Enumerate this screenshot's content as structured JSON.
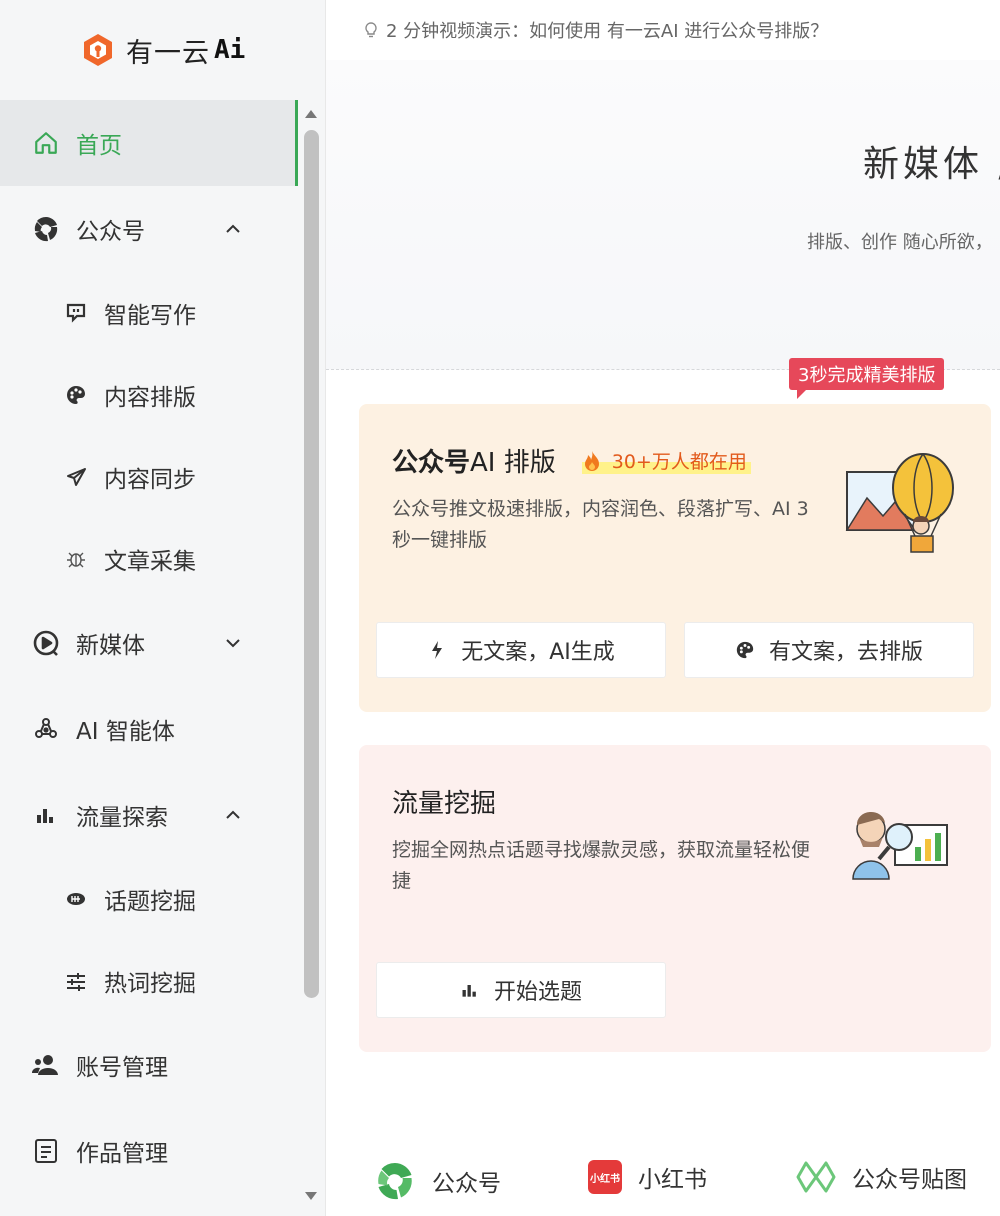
{
  "brand": {
    "name": "有一云",
    "ai_mark": "Ai",
    "logo_color": "#f0672b"
  },
  "sidebar": {
    "accent": "#3aa856",
    "items": [
      {
        "label": "首页",
        "icon": "home-icon",
        "level": "top",
        "active": true
      },
      {
        "label": "公众号",
        "icon": "wechat-official-icon",
        "level": "top",
        "chevron": "up"
      },
      {
        "label": "智能写作",
        "icon": "chat-write-icon",
        "level": "sub"
      },
      {
        "label": "内容排版",
        "icon": "palette-icon",
        "level": "sub"
      },
      {
        "label": "内容同步",
        "icon": "send-icon",
        "level": "sub"
      },
      {
        "label": "文章采集",
        "icon": "bug-icon",
        "level": "sub"
      },
      {
        "label": "新媒体",
        "icon": "play-circle-icon",
        "level": "top",
        "chevron": "down"
      },
      {
        "label": "AI 智能体",
        "icon": "agent-icon",
        "level": "top"
      },
      {
        "label": "流量探索",
        "icon": "bar-chart-icon",
        "level": "top",
        "chevron": "up"
      },
      {
        "label": "话题挖掘",
        "icon": "topic-icon",
        "level": "sub"
      },
      {
        "label": "热词挖掘",
        "icon": "sliders-icon",
        "level": "sub"
      },
      {
        "label": "账号管理",
        "icon": "users-icon",
        "level": "top"
      },
      {
        "label": "作品管理",
        "icon": "document-icon",
        "level": "top"
      }
    ]
  },
  "tip": {
    "text": "2 分钟视频演示：如何使用 有一云AI 进行公众号排版？"
  },
  "hero": {
    "title": "新媒体 /",
    "subtitle": "排版、创作 随心所欲，"
  },
  "ribbon": {
    "text": "3秒完成精美排版",
    "color": "#e6485a"
  },
  "cards": [
    {
      "title_bold": "公众号",
      "title_rest": " AI 排版",
      "badge": "30+万人都在用",
      "desc": "公众号推文极速排版，内容润色、段落扩写、AI 3秒一键排版",
      "bg": "#fdf1e2",
      "buttons": [
        {
          "label": "无文案，AI生成",
          "icon": "flash-icon"
        },
        {
          "label": "有文案，去排版",
          "icon": "palette-icon"
        }
      ]
    },
    {
      "title": "流量挖掘",
      "desc": "挖掘全网热点话题寻找爆款灵感，获取流量轻松便捷",
      "bg": "#fdf0ee",
      "buttons": [
        {
          "label": "开始选题",
          "icon": "bar-chart-icon"
        }
      ]
    }
  ],
  "platforms": [
    {
      "label": "公众号",
      "icon": "wechat-official-icon"
    },
    {
      "label": "小红书",
      "icon": "xiaohongshu-icon",
      "icon_text": "小红书"
    },
    {
      "label": "公众号贴图",
      "icon": "image-post-icon"
    }
  ]
}
